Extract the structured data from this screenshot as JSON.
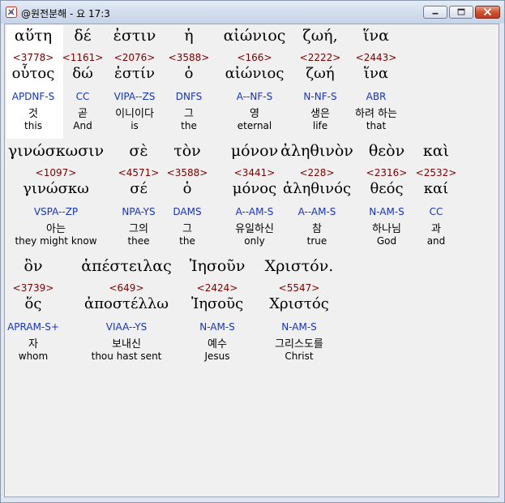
{
  "window": {
    "title": "@원전분해 - 요 17:3",
    "app_icon": "interlinear-app-icon",
    "buttons": {
      "minimize": "minimize-icon",
      "maximize": "maximize-icon",
      "close": "close-icon"
    }
  },
  "rows": [
    {
      "words": [
        {
          "greek": "αὕτη",
          "strong": "<3778>",
          "lemma": "οὗτος",
          "parsing": "APDNF-S",
          "korean": "것",
          "english": "this",
          "highlighted": true
        },
        {
          "greek": "δέ",
          "strong": "<1161>",
          "lemma": "δώ",
          "parsing": "CC",
          "korean": "곧",
          "english": "And"
        },
        {
          "greek": "ἐστιν",
          "strong": "<2076>",
          "lemma": "ἐστίν",
          "parsing": "VIPA--ZS",
          "korean": "이니이다",
          "english": "is"
        },
        {
          "greek": "ἡ",
          "strong": "<3588>",
          "lemma": "ὁ",
          "parsing": "DNFS",
          "korean": "그",
          "english": "the"
        },
        {
          "greek": "αἰώνιος",
          "strong": "<166>",
          "lemma": "αἰώνιος",
          "parsing": "A--NF-S",
          "korean": "영",
          "english": "eternal"
        },
        {
          "greek": "ζωή,",
          "strong": "<2222>",
          "lemma": "ζωή",
          "parsing": "N-NF-S",
          "korean": "생은",
          "english": "life"
        },
        {
          "greek": "ἵνα",
          "strong": "<2443>",
          "lemma": "ἵνα",
          "parsing": "ABR",
          "korean": "하려 하는",
          "english": "that"
        }
      ]
    },
    {
      "words": [
        {
          "greek": "γινώσκωσιν",
          "strong": "<1097>",
          "lemma": "γινώσκω",
          "parsing": "VSPA--ZP",
          "korean": "아는",
          "english": "they might know"
        },
        {
          "greek": "σὲ",
          "strong": "<4571>",
          "lemma": "σέ",
          "parsing": "NPA-YS",
          "korean": "그의",
          "english": "thee"
        },
        {
          "greek": "τὸν",
          "strong": "<3588>",
          "lemma": "ὁ",
          "parsing": "DAMS",
          "korean": "그",
          "english": "the"
        },
        {
          "greek": "μόνον",
          "strong": "<3441>",
          "lemma": "μόνος",
          "parsing": "A--AM-S",
          "korean": "유일하신",
          "english": "only"
        },
        {
          "greek": "ἀληθινὸν",
          "strong": "<228>",
          "lemma": "ἀληθινός",
          "parsing": "A--AM-S",
          "korean": "참",
          "english": "true"
        },
        {
          "greek": "θεὸν",
          "strong": "<2316>",
          "lemma": "θεός",
          "parsing": "N-AM-S",
          "korean": "하나님",
          "english": "God"
        },
        {
          "greek": "καὶ",
          "strong": "<2532>",
          "lemma": "καί",
          "parsing": "CC",
          "korean": "과",
          "english": "and"
        }
      ]
    },
    {
      "words": [
        {
          "greek": "ὃν",
          "strong": "<3739>",
          "lemma": "ὅς",
          "parsing": "APRAM-S+",
          "korean": "자",
          "english": "whom"
        },
        {
          "greek": "ἀπέστειλας",
          "strong": "<649>",
          "lemma": "ἀποστέλλω",
          "parsing": "VIAA--YS",
          "korean": "보내신",
          "english": "thou hast sent"
        },
        {
          "greek": "Ἰησοῦν",
          "strong": "<2424>",
          "lemma": "Ἰησοῦς",
          "parsing": "N-AM-S",
          "korean": "예수",
          "english": "Jesus"
        },
        {
          "greek": "Χριστόν.",
          "strong": "<5547>",
          "lemma": "Χριστός",
          "parsing": "N-AM-S",
          "korean": "그리스도를",
          "english": "Christ"
        }
      ]
    }
  ]
}
